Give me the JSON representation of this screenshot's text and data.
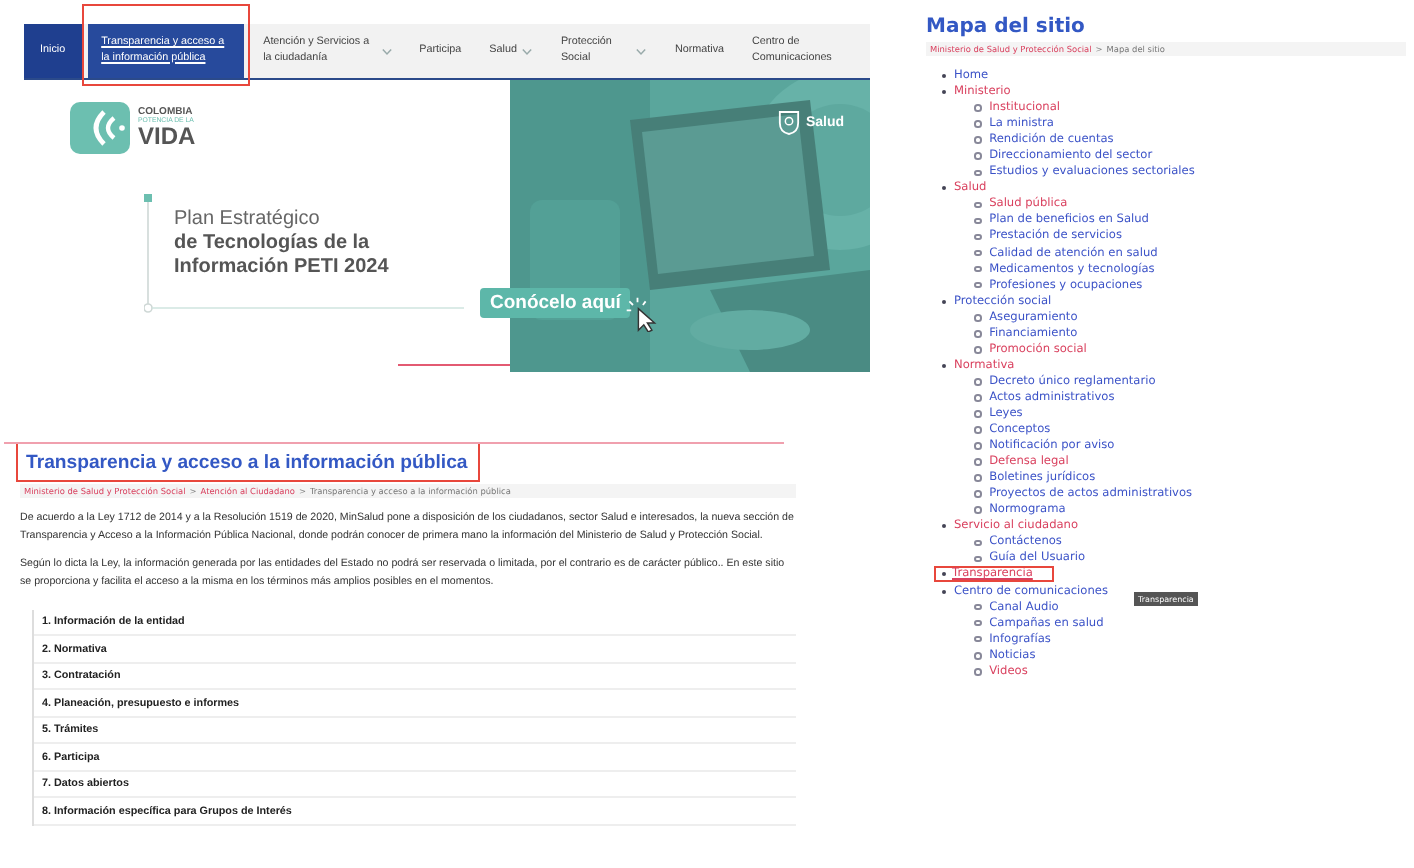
{
  "nav": {
    "items": [
      {
        "label": "Inicio",
        "selected": true,
        "hovered": false,
        "dropdown": false,
        "highlighted": false
      },
      {
        "label": "Transparencia y acceso a la información pública",
        "selected": false,
        "hovered": true,
        "dropdown": false,
        "highlighted": true
      },
      {
        "label": "Atención y Servicios a la ciudadanía",
        "selected": false,
        "hovered": false,
        "dropdown": true,
        "highlighted": false
      },
      {
        "label": "Participa",
        "selected": false,
        "hovered": false,
        "dropdown": false,
        "highlighted": false
      },
      {
        "label": "Salud",
        "selected": false,
        "hovered": false,
        "dropdown": true,
        "highlighted": false
      },
      {
        "label": "Protección Social",
        "selected": false,
        "hovered": false,
        "dropdown": true,
        "highlighted": false
      },
      {
        "label": "Normativa",
        "selected": false,
        "hovered": false,
        "dropdown": false,
        "highlighted": false
      },
      {
        "label": "Centro de Comunicaciones",
        "selected": false,
        "hovered": false,
        "dropdown": false,
        "highlighted": false
      }
    ]
  },
  "banner": {
    "logo": {
      "line1": "COLOMBIA",
      "line2": "POTENCIA DE LA",
      "line3": "VIDA"
    },
    "brand": "Salud",
    "title": {
      "lead": "Plan Estratégico",
      "main": [
        "de Tecnologías de la",
        "Información PETI 2024"
      ]
    },
    "button": "Conócelo aquí"
  },
  "page": {
    "title": "Transparencia y acceso a la información pública",
    "title_highlighted": true,
    "breadcrumb": [
      {
        "label": "Ministerio de Salud y Protección Social",
        "link": true
      },
      {
        "label": "Atención al Ciudadano",
        "link": true
      },
      {
        "label": "Transparencia y acceso a la información pública",
        "link": false
      }
    ],
    "separator": ">",
    "paragraphs": [
      "De acuerdo a la Ley 1712 de 2014 y a la Resolución 1519 de 2020, MinSalud pone a disposición de los ciudadanos, sector Salud e interesados, la nueva sección de Transparencia y Acceso a la Información Pública Nacional, donde podrán conocer de primera mano la información del Ministerio de Salud y Protección Social.",
      "Según lo dicta la Ley, la información generada por las entidades del Estado no podrá ser reservada o limitada, por el contrario es de carácter público.. En este sitio se proporciona y facilita el acceso a la misma en los términos más amplios posibles en el momentos."
    ],
    "sections": [
      "1. Información de la entidad",
      "2. Normativa",
      "3. Contratación",
      "4. Planeación, presupuesto e informes",
      "5. Trámites",
      "6. Participa",
      "7. Datos abiertos",
      "8. Información específica para Grupos de Interés"
    ]
  },
  "sitemap": {
    "title": "Mapa del sitio",
    "breadcrumb": [
      {
        "label": "Ministerio de Salud y Protección Social",
        "link": true
      },
      {
        "label": "Mapa del sitio",
        "link": false
      }
    ],
    "separator": ">",
    "items": [
      {
        "label": "Home",
        "visited": false,
        "highlighted": false
      },
      {
        "label": "Ministerio",
        "visited": true,
        "highlighted": false,
        "children": [
          {
            "label": "Institucional",
            "visited": true,
            "highlighted": false
          },
          {
            "label": "La ministra",
            "visited": false,
            "highlighted": false
          },
          {
            "label": "Rendición de cuentas",
            "visited": false,
            "highlighted": false
          },
          {
            "label": "Direccionamiento del sector",
            "visited": false,
            "highlighted": false
          },
          {
            "label": "Estudios y evaluaciones sectoriales",
            "visited": false,
            "highlighted": false
          }
        ]
      },
      {
        "label": "Salud",
        "visited": true,
        "highlighted": false,
        "children": [
          {
            "label": "Salud pública",
            "visited": true,
            "highlighted": false
          },
          {
            "label": "Plan de beneficios en Salud",
            "visited": false,
            "highlighted": false
          },
          {
            "label": "Prestación de servicios",
            "visited": false,
            "highlighted": false
          },
          {
            "label": "Calidad de atención en salud",
            "visited": false,
            "highlighted": false
          },
          {
            "label": "Medicamentos y tecnologías",
            "visited": false,
            "highlighted": false
          },
          {
            "label": "Profesiones y ocupaciones",
            "visited": false,
            "highlighted": false
          }
        ]
      },
      {
        "label": "Protección social",
        "visited": false,
        "highlighted": false,
        "children": [
          {
            "label": "Aseguramiento",
            "visited": false,
            "highlighted": false
          },
          {
            "label": "Financiamiento",
            "visited": false,
            "highlighted": false
          },
          {
            "label": "Promoción social",
            "visited": true,
            "highlighted": false
          }
        ]
      },
      {
        "label": "Normativa",
        "visited": true,
        "highlighted": false,
        "children": [
          {
            "label": "Decreto único reglamentario",
            "visited": false,
            "highlighted": false
          },
          {
            "label": "Actos administrativos",
            "visited": false,
            "highlighted": false
          },
          {
            "label": "Leyes",
            "visited": false,
            "highlighted": false
          },
          {
            "label": "Conceptos",
            "visited": false,
            "highlighted": false
          },
          {
            "label": "Notificación por aviso",
            "visited": false,
            "highlighted": false
          },
          {
            "label": "Defensa legal",
            "visited": true,
            "highlighted": false
          },
          {
            "label": "Boletines jurídicos",
            "visited": false,
            "highlighted": false
          },
          {
            "label": "Proyectos de actos administrativos",
            "visited": false,
            "highlighted": false
          },
          {
            "label": "Normograma",
            "visited": false,
            "highlighted": false
          }
        ]
      },
      {
        "label": "Servicio al ciudadano",
        "visited": true,
        "highlighted": false,
        "children": [
          {
            "label": "Contáctenos",
            "visited": false,
            "highlighted": false
          },
          {
            "label": "Guía del Usuario",
            "visited": false,
            "highlighted": false
          }
        ]
      },
      {
        "label": "Transparencia",
        "visited": true,
        "highlighted": true,
        "tooltip": "Transparencia"
      },
      {
        "label": "Centro de comunicaciones",
        "visited": false,
        "highlighted": false,
        "children": [
          {
            "label": "Canal Audio",
            "visited": false,
            "highlighted": false
          },
          {
            "label": "Campañas en salud",
            "visited": false,
            "highlighted": false
          },
          {
            "label": "Infografías",
            "visited": false,
            "highlighted": false
          },
          {
            "label": "Noticias",
            "visited": false,
            "highlighted": false
          },
          {
            "label": "Videos",
            "visited": true,
            "highlighted": false
          }
        ]
      }
    ]
  }
}
